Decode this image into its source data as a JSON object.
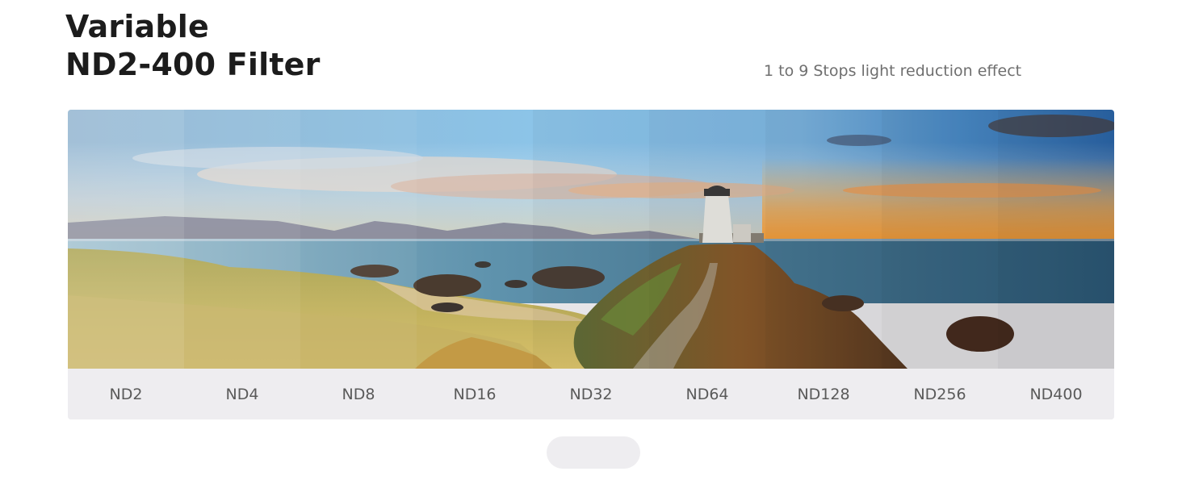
{
  "header": {
    "title_line1": "Variable",
    "title_line2": "ND2-400 Filter",
    "subtitle": "1 to 9 Stops light reduction effect"
  },
  "image": {
    "icon": "lighthouse-landscape-photo"
  },
  "filters": [
    {
      "label": "ND2"
    },
    {
      "label": "ND4"
    },
    {
      "label": "ND8"
    },
    {
      "label": "ND16"
    },
    {
      "label": "ND32"
    },
    {
      "label": "ND64"
    },
    {
      "label": "ND128"
    },
    {
      "label": "ND256"
    },
    {
      "label": "ND400"
    }
  ],
  "colors": {
    "title": "#1c1c1c",
    "subtitle": "#6f6f6f",
    "label_bar": "#eeedf0",
    "label_text": "#5a5a5a"
  }
}
